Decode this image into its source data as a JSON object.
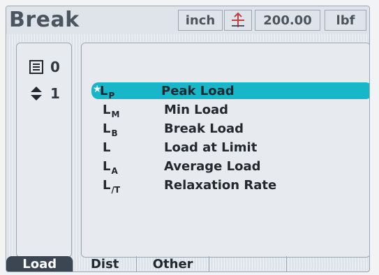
{
  "screen": {
    "title": "Break"
  },
  "toolbar": {
    "unit": "inch",
    "limit_value": "200.00",
    "load_unit": "lbf",
    "icons": [
      "limit-icon"
    ]
  },
  "left_panel": {
    "counters": [
      {
        "icon": "list-icon",
        "value": "0"
      },
      {
        "icon": "updown-icon",
        "value": "1"
      }
    ]
  },
  "main_list": {
    "selected_index": 0,
    "items": [
      {
        "symbol": "L",
        "subscript": "P",
        "label": "Peak Load"
      },
      {
        "symbol": "L",
        "subscript": "M",
        "label": "Min Load"
      },
      {
        "symbol": "L",
        "subscript": "B",
        "label": "Break Load"
      },
      {
        "symbol": "L",
        "subscript": "",
        "label": "Load at Limit"
      },
      {
        "symbol": "L",
        "subscript": "A",
        "label": "Average Load"
      },
      {
        "symbol": "L",
        "subscript": "/T",
        "label": "Relaxation Rate"
      }
    ]
  },
  "tabs": [
    {
      "label": "Load",
      "active": true
    },
    {
      "label": "Dist",
      "active": false
    },
    {
      "label": "Other",
      "active": false
    },
    {
      "label": "",
      "active": false
    },
    {
      "label": "",
      "active": false
    }
  ],
  "colors": {
    "selection": "#17b6c8",
    "active_tab": "#3b4652"
  }
}
